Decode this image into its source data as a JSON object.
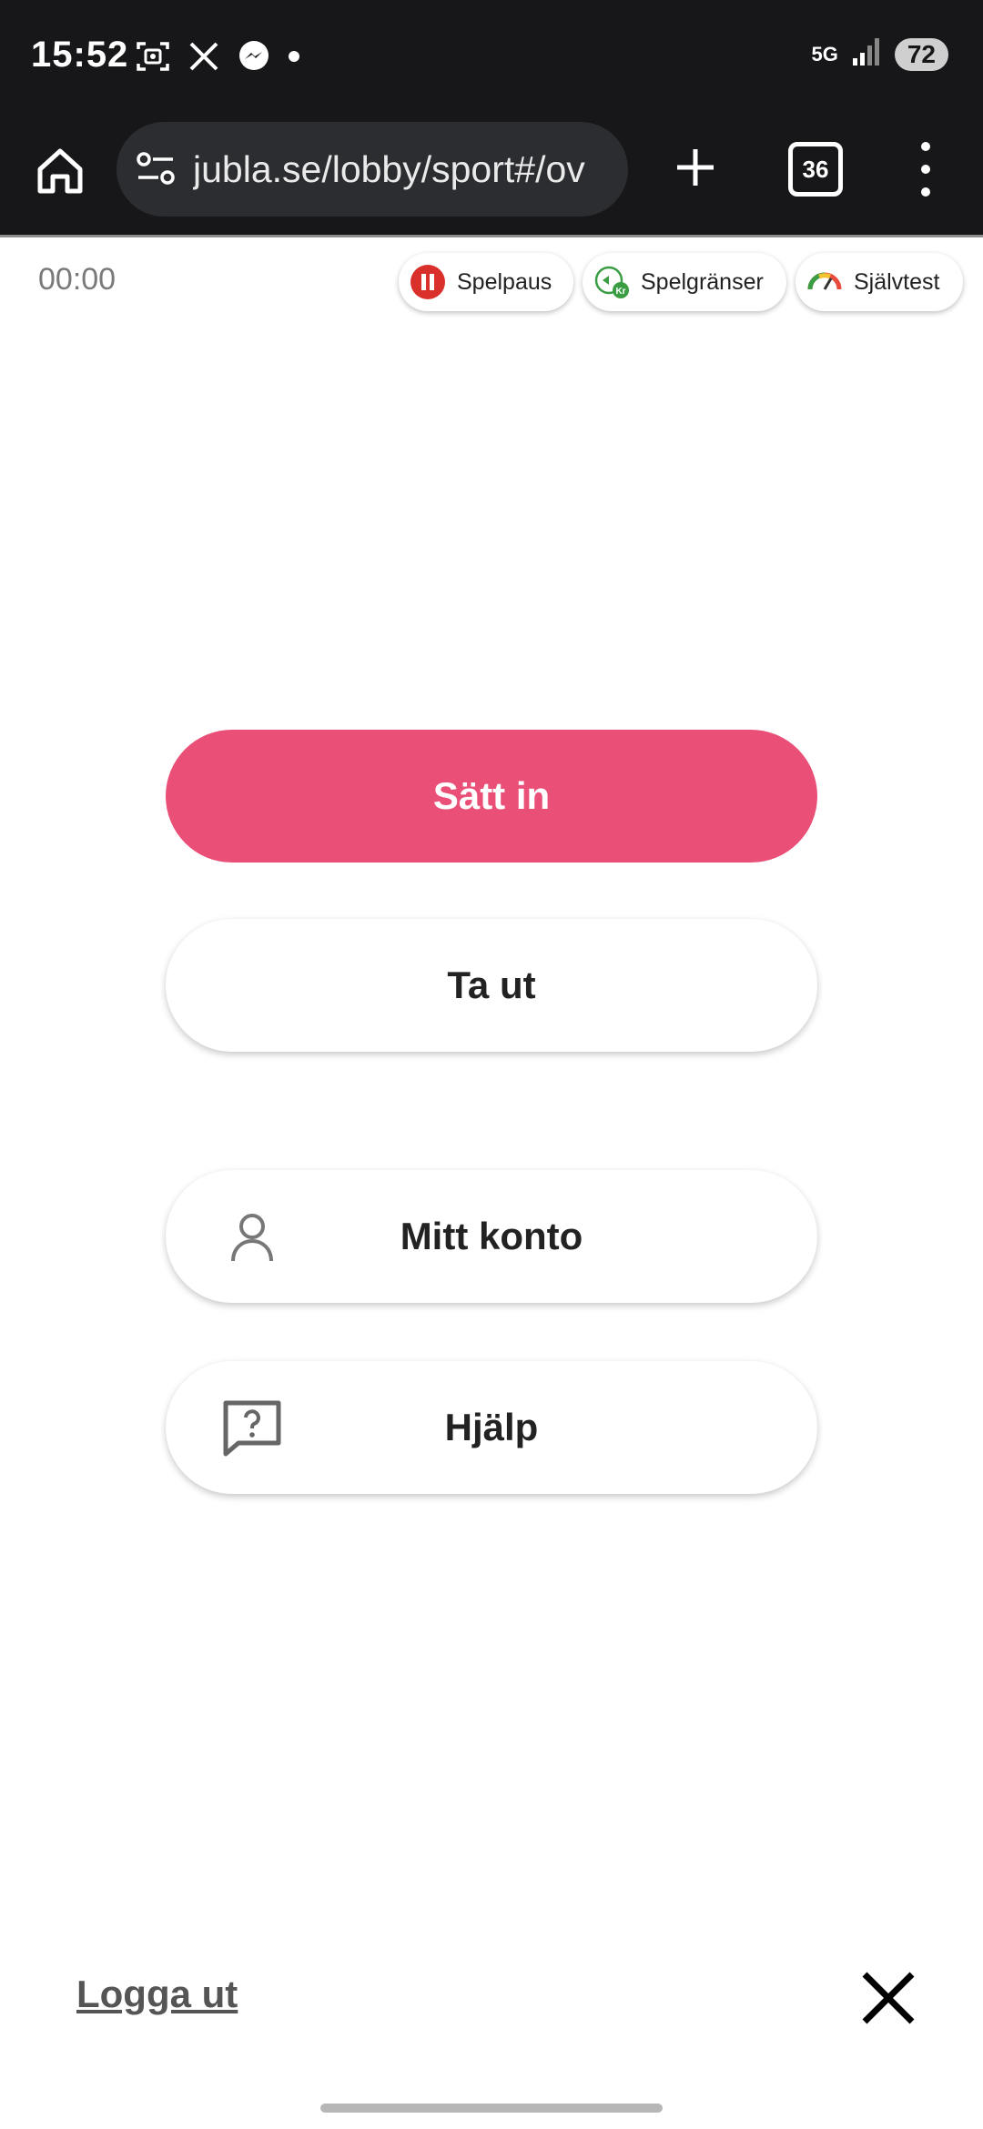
{
  "status_bar": {
    "time": "15:52",
    "network": "5G",
    "battery": "72",
    "icons": [
      "screenshot-icon",
      "x-logo-icon",
      "messenger-icon",
      "dot-icon",
      "signal-icon"
    ]
  },
  "browser": {
    "url": "jubla.se/lobby/sport#/ov",
    "tab_count": "36",
    "icons": [
      "home-icon",
      "site-settings-icon",
      "new-tab-plus-icon",
      "tabs-icon",
      "overflow-menu-icon"
    ]
  },
  "responsible_gaming": {
    "timer": "00:00",
    "pause_label": "Spelpaus",
    "limits_label": "Spelgränser",
    "selftest_label": "Självtest",
    "colors": {
      "pause": "#d9302c",
      "limits": "#3a9d44"
    }
  },
  "actions": {
    "deposit_label": "Sätt in",
    "withdraw_label": "Ta ut",
    "account_label": "Mitt konto",
    "help_label": "Hjälp"
  },
  "footer": {
    "logout_label": "Logga ut"
  },
  "colors": {
    "accent": "#ea5077",
    "chrome": "#17171a",
    "url_box": "#2c2d31"
  }
}
